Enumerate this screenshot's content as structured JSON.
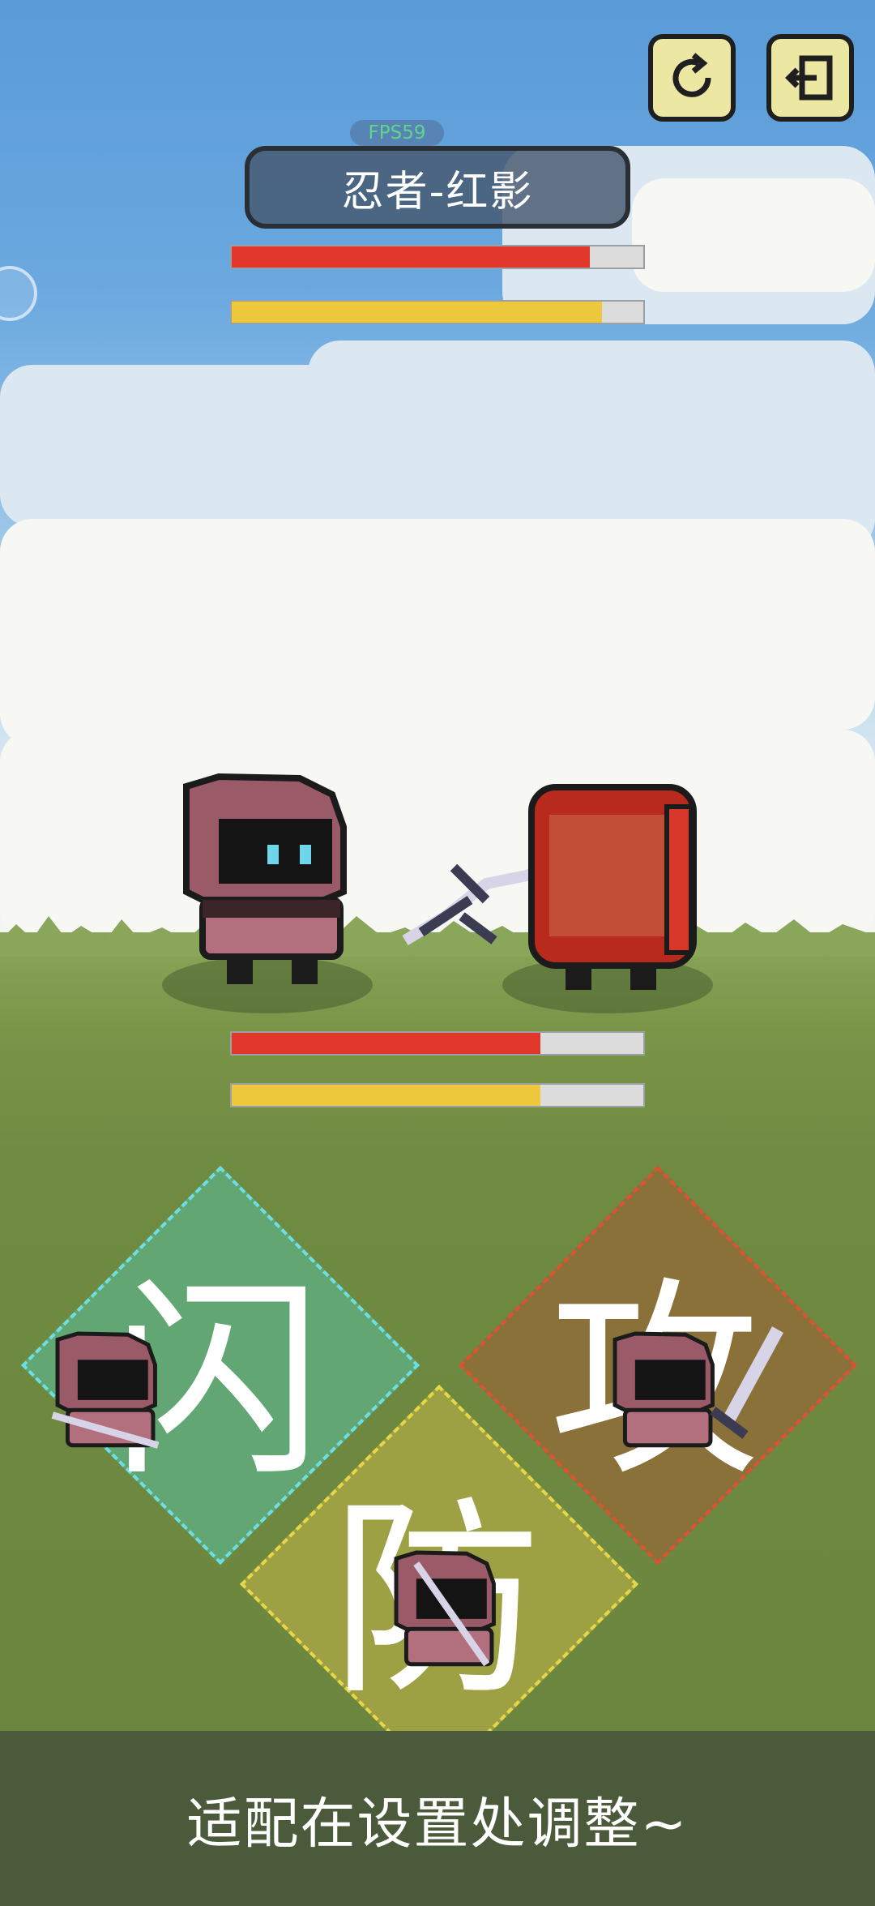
{
  "hud": {
    "fps": "FPS59",
    "enemy_name": "忍者-红影",
    "enemy_hp": 0.87,
    "enemy_sp": 0.9,
    "player_hp": 0.75,
    "player_sp": 0.75,
    "refresh_icon": "refresh-icon",
    "exit_icon": "exit-icon"
  },
  "actions": {
    "dodge": {
      "label": "闪",
      "color": "#62a673"
    },
    "attack": {
      "label": "攻",
      "color": "#8a7039"
    },
    "defend": {
      "label": "防",
      "color": "#9da144"
    }
  },
  "footer": {
    "hint": "适配在设置处调整~"
  },
  "colors": {
    "hp": "#e1382b",
    "sp": "#edc83c",
    "enemy": "#b82a1d",
    "player": "#9a5a68"
  }
}
